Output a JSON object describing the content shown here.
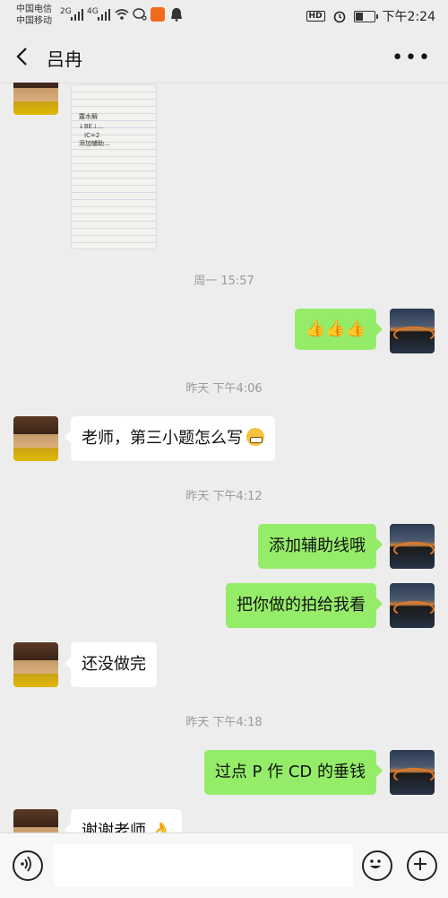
{
  "status_bar": {
    "carrier_1": "中国电信",
    "carrier_2": "中国移动",
    "net_1": "2G",
    "net_2": "4G",
    "hd_label": "HD",
    "time": "下午2:24"
  },
  "header": {
    "title": "吕冉"
  },
  "messages": [
    {
      "type": "image",
      "sender": "other",
      "image_text": [
        "露水解",
        "↓BE⊥...",
        "IC=2",
        "添加辅助..."
      ]
    },
    {
      "type": "time",
      "text": "周一 15:57"
    },
    {
      "type": "text",
      "sender": "me",
      "text": "👍👍👍"
    },
    {
      "type": "time",
      "text": "昨天 下午4:06"
    },
    {
      "type": "text",
      "sender": "other",
      "text": "老师，第三小题怎么写",
      "emoji": "grimace-emoji"
    },
    {
      "type": "time",
      "text": "昨天 下午4:12"
    },
    {
      "type": "text",
      "sender": "me",
      "text": "添加辅助线哦"
    },
    {
      "type": "text",
      "sender": "me",
      "text": "把你做的拍给我看"
    },
    {
      "type": "text",
      "sender": "other",
      "text": "还没做完"
    },
    {
      "type": "time",
      "text": "昨天 下午4:18"
    },
    {
      "type": "text",
      "sender": "me",
      "text": "过点 P 作 CD 的垂钱"
    },
    {
      "type": "text",
      "sender": "other",
      "text": "谢谢老师 👌"
    }
  ],
  "input_bar": {
    "voice_icon": "voice-icon",
    "emoji_icon": "smile-icon",
    "plus_icon": "plus-icon",
    "placeholder": ""
  },
  "colors": {
    "background": "#ededed",
    "outgoing_bubble": "#95ec69",
    "incoming_bubble": "#ffffff",
    "timestamp": "#9a9a9a"
  }
}
